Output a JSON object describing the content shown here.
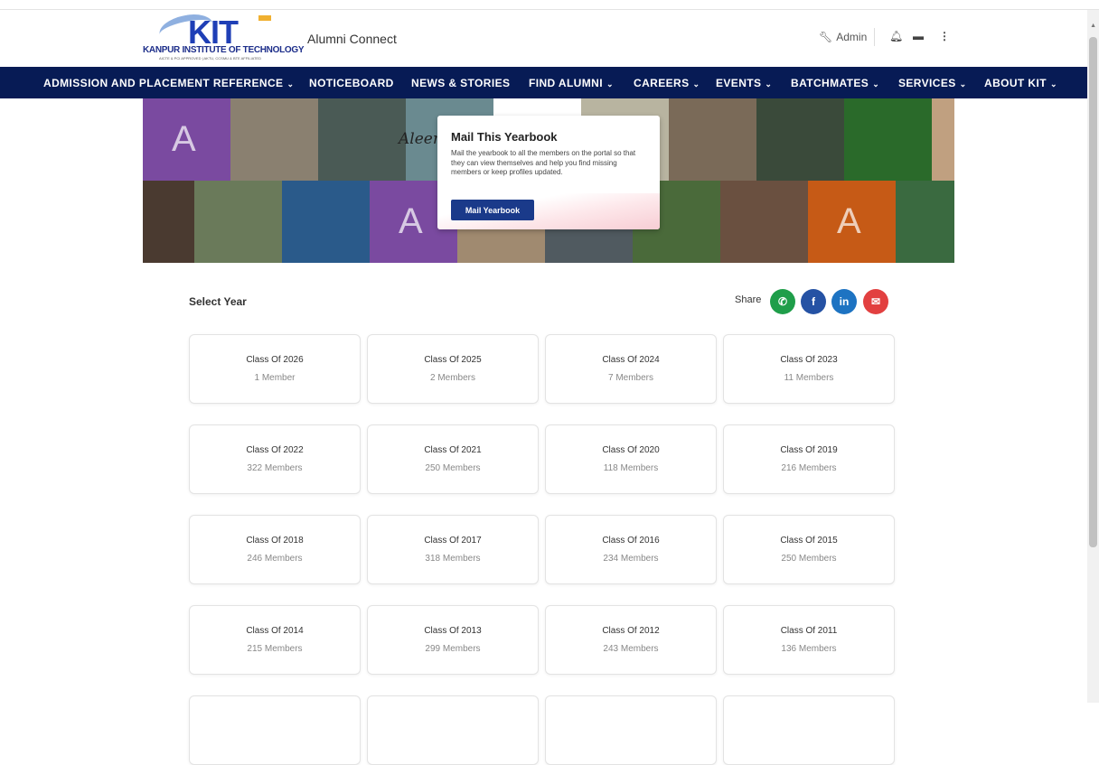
{
  "header": {
    "logo_text": "KANPUR INSTITUTE OF TECHNOLOGY",
    "logo_letters": "KIT",
    "logo_sub": "AICTE & PCI APPROVED | AKTU, CCSMU & BTE AFFILIATED",
    "app_title": "Alumni Connect",
    "admin_label": "Admin"
  },
  "nav": {
    "items": [
      {
        "label": "ADMISSION AND PLACEMENT REFERENCE",
        "dropdown": true
      },
      {
        "label": "NOTICEBOARD",
        "dropdown": false
      },
      {
        "label": "NEWS & STORIES",
        "dropdown": false
      },
      {
        "label": "FIND ALUMNI",
        "dropdown": true
      },
      {
        "label": "CAREERS",
        "dropdown": true
      },
      {
        "label": "EVENTS",
        "dropdown": true
      },
      {
        "label": "BATCHMATES",
        "dropdown": true
      },
      {
        "label": "SERVICES",
        "dropdown": true
      },
      {
        "label": "ABOUT KIT",
        "dropdown": true
      }
    ]
  },
  "banner": {
    "tile_letter": "A",
    "caption": "Aleem"
  },
  "popup": {
    "title": "Mail This Yearbook",
    "text": "Mail the yearbook to all the members on the portal so that they can view themselves and help you find missing members or keep profiles updated.",
    "button": "Mail Yearbook"
  },
  "section": {
    "select_year": "Select Year",
    "share_label": "Share"
  },
  "share": [
    {
      "name": "whatsapp",
      "glyph": "✆",
      "color": "#1f9e4a"
    },
    {
      "name": "facebook",
      "glyph": "f",
      "color": "#2552a4"
    },
    {
      "name": "linkedin",
      "glyph": "in",
      "color": "#1d73c2"
    },
    {
      "name": "email",
      "glyph": "✉",
      "color": "#e24040"
    }
  ],
  "years": [
    {
      "title": "Class Of 2026",
      "members": "1 Member"
    },
    {
      "title": "Class Of 2025",
      "members": "2 Members"
    },
    {
      "title": "Class Of 2024",
      "members": "7 Members"
    },
    {
      "title": "Class Of 2023",
      "members": "11 Members"
    },
    {
      "title": "Class Of 2022",
      "members": "322 Members"
    },
    {
      "title": "Class Of 2021",
      "members": "250 Members"
    },
    {
      "title": "Class Of 2020",
      "members": "118 Members"
    },
    {
      "title": "Class Of 2019",
      "members": "216 Members"
    },
    {
      "title": "Class Of 2018",
      "members": "246 Members"
    },
    {
      "title": "Class Of 2017",
      "members": "318 Members"
    },
    {
      "title": "Class Of 2016",
      "members": "234 Members"
    },
    {
      "title": "Class Of 2015",
      "members": "250 Members"
    },
    {
      "title": "Class Of 2014",
      "members": "215 Members"
    },
    {
      "title": "Class Of 2013",
      "members": "299 Members"
    },
    {
      "title": "Class Of 2012",
      "members": "243 Members"
    },
    {
      "title": "Class Of 2011",
      "members": "136 Members"
    }
  ],
  "colors": {
    "nav_bg": "#071b55",
    "accent": "#1a3a8a"
  }
}
